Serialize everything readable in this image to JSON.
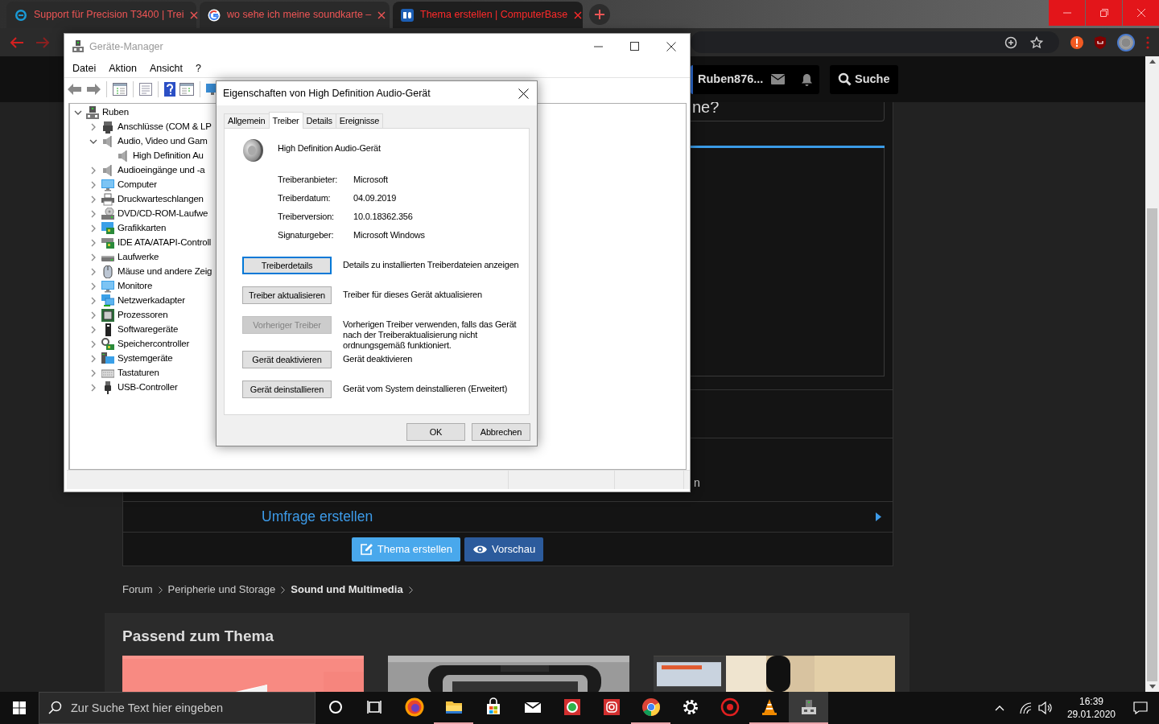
{
  "browser": {
    "tabs": [
      {
        "title": "Support für Precision T3400 | Trei",
        "selected": false
      },
      {
        "title": "wo sehe ich meine soundkarte –",
        "selected": false
      },
      {
        "title": "Thema erstellen | ComputerBase",
        "selected": true
      }
    ]
  },
  "forum": {
    "user": "Ruben876...",
    "search": "Suche",
    "title_fragment": "ne?",
    "column_fragment": "n",
    "poll": "Umfrage erstellen",
    "actions": [
      {
        "label": "Thema erstellen",
        "kind": "primary"
      },
      {
        "label": "Vorschau",
        "kind": "secondary"
      }
    ],
    "breadcrumbs": [
      {
        "label": "Forum",
        "current": false
      },
      {
        "label": "Peripherie und Storage",
        "current": false
      },
      {
        "label": "Sound und Multimedia",
        "current": true
      }
    ],
    "related_title": "Passend zum Thema"
  },
  "device_manager": {
    "title": "Geräte-Manager",
    "menu": [
      "Datei",
      "Aktion",
      "Ansicht",
      "?"
    ],
    "tree": {
      "label": "Ruben",
      "kind": "computer-root",
      "expanded": true,
      "children": [
        {
          "label": "Anschlüsse (COM & LP",
          "kind": "port",
          "expanded": false
        },
        {
          "label": "Audio, Video und Gam",
          "kind": "audio",
          "expanded": true,
          "children": [
            {
              "label": "High Definition Au",
              "kind": "audio"
            }
          ]
        },
        {
          "label": "Audioeingänge und -a",
          "kind": "audio",
          "expanded": false
        },
        {
          "label": "Computer",
          "kind": "computer",
          "expanded": false
        },
        {
          "label": "Druckwarteschlangen",
          "kind": "printer",
          "expanded": false
        },
        {
          "label": "DVD/CD-ROM-Laufwe",
          "kind": "disc",
          "expanded": false
        },
        {
          "label": "Grafikkarten",
          "kind": "display",
          "expanded": false
        },
        {
          "label": "IDE ATA/ATAPI-Controll",
          "kind": "ide",
          "expanded": false
        },
        {
          "label": "Laufwerke",
          "kind": "drive",
          "expanded": false
        },
        {
          "label": "Mäuse und andere Zeig",
          "kind": "mouse",
          "expanded": false
        },
        {
          "label": "Monitore",
          "kind": "computer",
          "expanded": false
        },
        {
          "label": "Netzwerkadapter",
          "kind": "network",
          "expanded": false
        },
        {
          "label": "Prozessoren",
          "kind": "cpu",
          "expanded": false
        },
        {
          "label": "Softwaregeräte",
          "kind": "software",
          "expanded": false
        },
        {
          "label": "Speichercontroller",
          "kind": "storage",
          "expanded": false
        },
        {
          "label": "Systemgeräte",
          "kind": "system",
          "expanded": false
        },
        {
          "label": "Tastaturen",
          "kind": "keyboard",
          "expanded": false
        },
        {
          "label": "USB-Controller",
          "kind": "usb",
          "expanded": false
        }
      ]
    }
  },
  "properties_dialog": {
    "title": "Eigenschaften von High Definition Audio-Gerät",
    "tabs": [
      {
        "label": "Allgemein",
        "selected": false
      },
      {
        "label": "Treiber",
        "selected": true
      },
      {
        "label": "Details",
        "selected": false
      },
      {
        "label": "Ereignisse",
        "selected": false
      }
    ],
    "device_name": "High Definition Audio-Gerät",
    "properties": [
      {
        "label": "Treiberanbieter:",
        "value": "Microsoft"
      },
      {
        "label": "Treiberdatum:",
        "value": "04.09.2019"
      },
      {
        "label": "Treiberversion:",
        "value": "10.0.18362.356"
      },
      {
        "label": "Signaturgeber:",
        "value": "Microsoft Windows"
      }
    ],
    "actions": [
      {
        "button": "Treiberdetails",
        "description": "Details zu installierten Treiberdateien anzeigen",
        "disabled": false,
        "focused": true
      },
      {
        "button": "Treiber aktualisieren",
        "description": "Treiber für dieses Gerät aktualisieren",
        "disabled": false,
        "focused": false
      },
      {
        "button": "Vorheriger Treiber",
        "description": "Vorherigen Treiber verwenden, falls das Gerät nach der Treiberaktualisierung nicht ordnungsgemäß funktioniert.",
        "disabled": true,
        "focused": false
      },
      {
        "button": "Gerät deaktivieren",
        "description": "Gerät deaktivieren",
        "disabled": false,
        "focused": false
      },
      {
        "button": "Gerät deinstallieren",
        "description": "Gerät vom System deinstallieren (Erweitert)",
        "disabled": false,
        "focused": false
      }
    ],
    "buttons": [
      "OK",
      "Abbrechen"
    ]
  },
  "taskbar": {
    "search_placeholder": "Zur Suche Text hier eingeben",
    "apps": [
      {
        "kind": "cortana",
        "running": false,
        "active": false
      },
      {
        "kind": "taskview",
        "running": false,
        "active": false
      },
      {
        "kind": "firefox",
        "running": false,
        "active": false
      },
      {
        "kind": "explorer",
        "running": true,
        "active": false
      },
      {
        "kind": "store",
        "running": false,
        "active": false
      },
      {
        "kind": "mail",
        "running": false,
        "active": false
      },
      {
        "kind": "whatsapp",
        "running": false,
        "active": false
      },
      {
        "kind": "instagram",
        "running": false,
        "active": false
      },
      {
        "kind": "chrome",
        "running": true,
        "active": false
      },
      {
        "kind": "settings",
        "running": false,
        "active": false
      },
      {
        "kind": "redapp",
        "running": false,
        "active": false
      },
      {
        "kind": "vlc",
        "running": true,
        "active": false
      },
      {
        "kind": "devmgr",
        "running": true,
        "active": true
      }
    ],
    "time": "16:39",
    "date": "29.01.2020"
  }
}
